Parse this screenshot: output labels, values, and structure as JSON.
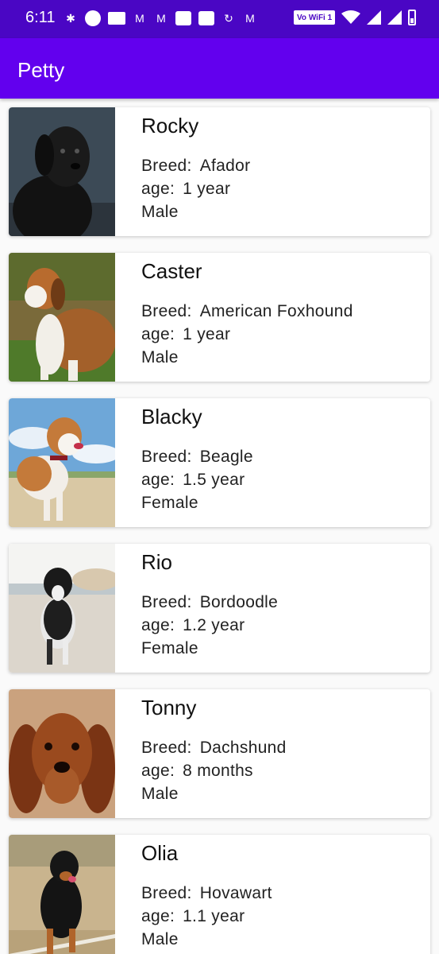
{
  "status_bar": {
    "time": "6:11",
    "wifi_label": "Vo WiFi 1",
    "icons": [
      "slack-icon",
      "circle-icon",
      "news-icon",
      "gmail-icon",
      "gmail-icon",
      "app-icon",
      "app-icon",
      "sync-icon",
      "m-icon",
      "wifi-icon",
      "signal-icon",
      "signal-icon",
      "battery-icon"
    ]
  },
  "app_bar": {
    "title": "Petty"
  },
  "labels": {
    "breed": "Breed:",
    "age": "age:"
  },
  "pets": [
    {
      "name": "Rocky",
      "breed": "Afador",
      "age": "1 year",
      "gender": "Male"
    },
    {
      "name": "Caster",
      "breed": "American Foxhound",
      "age": "1 year",
      "gender": "Male"
    },
    {
      "name": "Blacky",
      "breed": "Beagle",
      "age": "1.5 year",
      "gender": "Female"
    },
    {
      "name": "Rio",
      "breed": "Bordoodle",
      "age": "1.2 year",
      "gender": "Female"
    },
    {
      "name": "Tonny",
      "breed": "Dachshund",
      "age": "8 months",
      "gender": "Male"
    },
    {
      "name": "Olia",
      "breed": "Hovawart",
      "age": "1.1 year",
      "gender": "Male"
    }
  ],
  "colors": {
    "status_bar": "#4a06c4",
    "app_bar": "#6200ee"
  }
}
